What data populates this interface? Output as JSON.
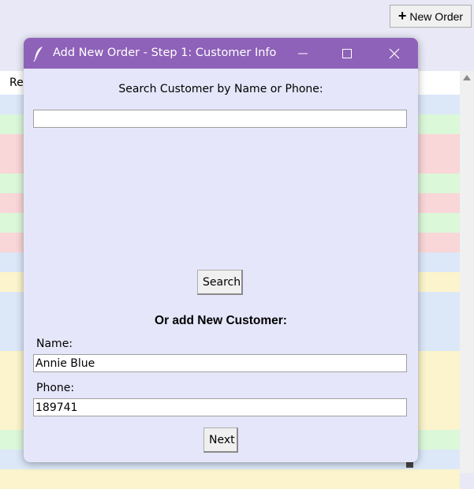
{
  "background_app": {
    "new_order_label": "New Order",
    "table_header_partial": "Re",
    "row_colors": [
      "#dce8f8",
      "#dbf8d9",
      "#f9d6d8",
      "#f9d6d8",
      "#dbf8d9",
      "#f9d6d8",
      "#dbf8d9",
      "#f9d6d8",
      "#dce8f8",
      "#fbf4cc",
      "#dce8f8",
      "#dce8f8",
      "#dce8f8",
      "#fbf4cc",
      "#fbf4cc",
      "#fbf4cc",
      "#fbf4cc",
      "#dbf8d9",
      "#dce8f8",
      "#fbf4cc"
    ]
  },
  "dialog": {
    "title": "Add New Order - Step 1: Customer Info",
    "search_label": "Search Customer by Name or Phone:",
    "search_value": "",
    "search_button": "Search",
    "new_customer_heading": "Or add New Customer:",
    "name_label": "Name:",
    "name_value": "Annie Blue",
    "phone_label": "Phone:",
    "phone_value": "189741",
    "next_button": "Next"
  },
  "colors": {
    "titlebar": "#8e62b8",
    "dialog_bg": "#e6e6fa"
  }
}
